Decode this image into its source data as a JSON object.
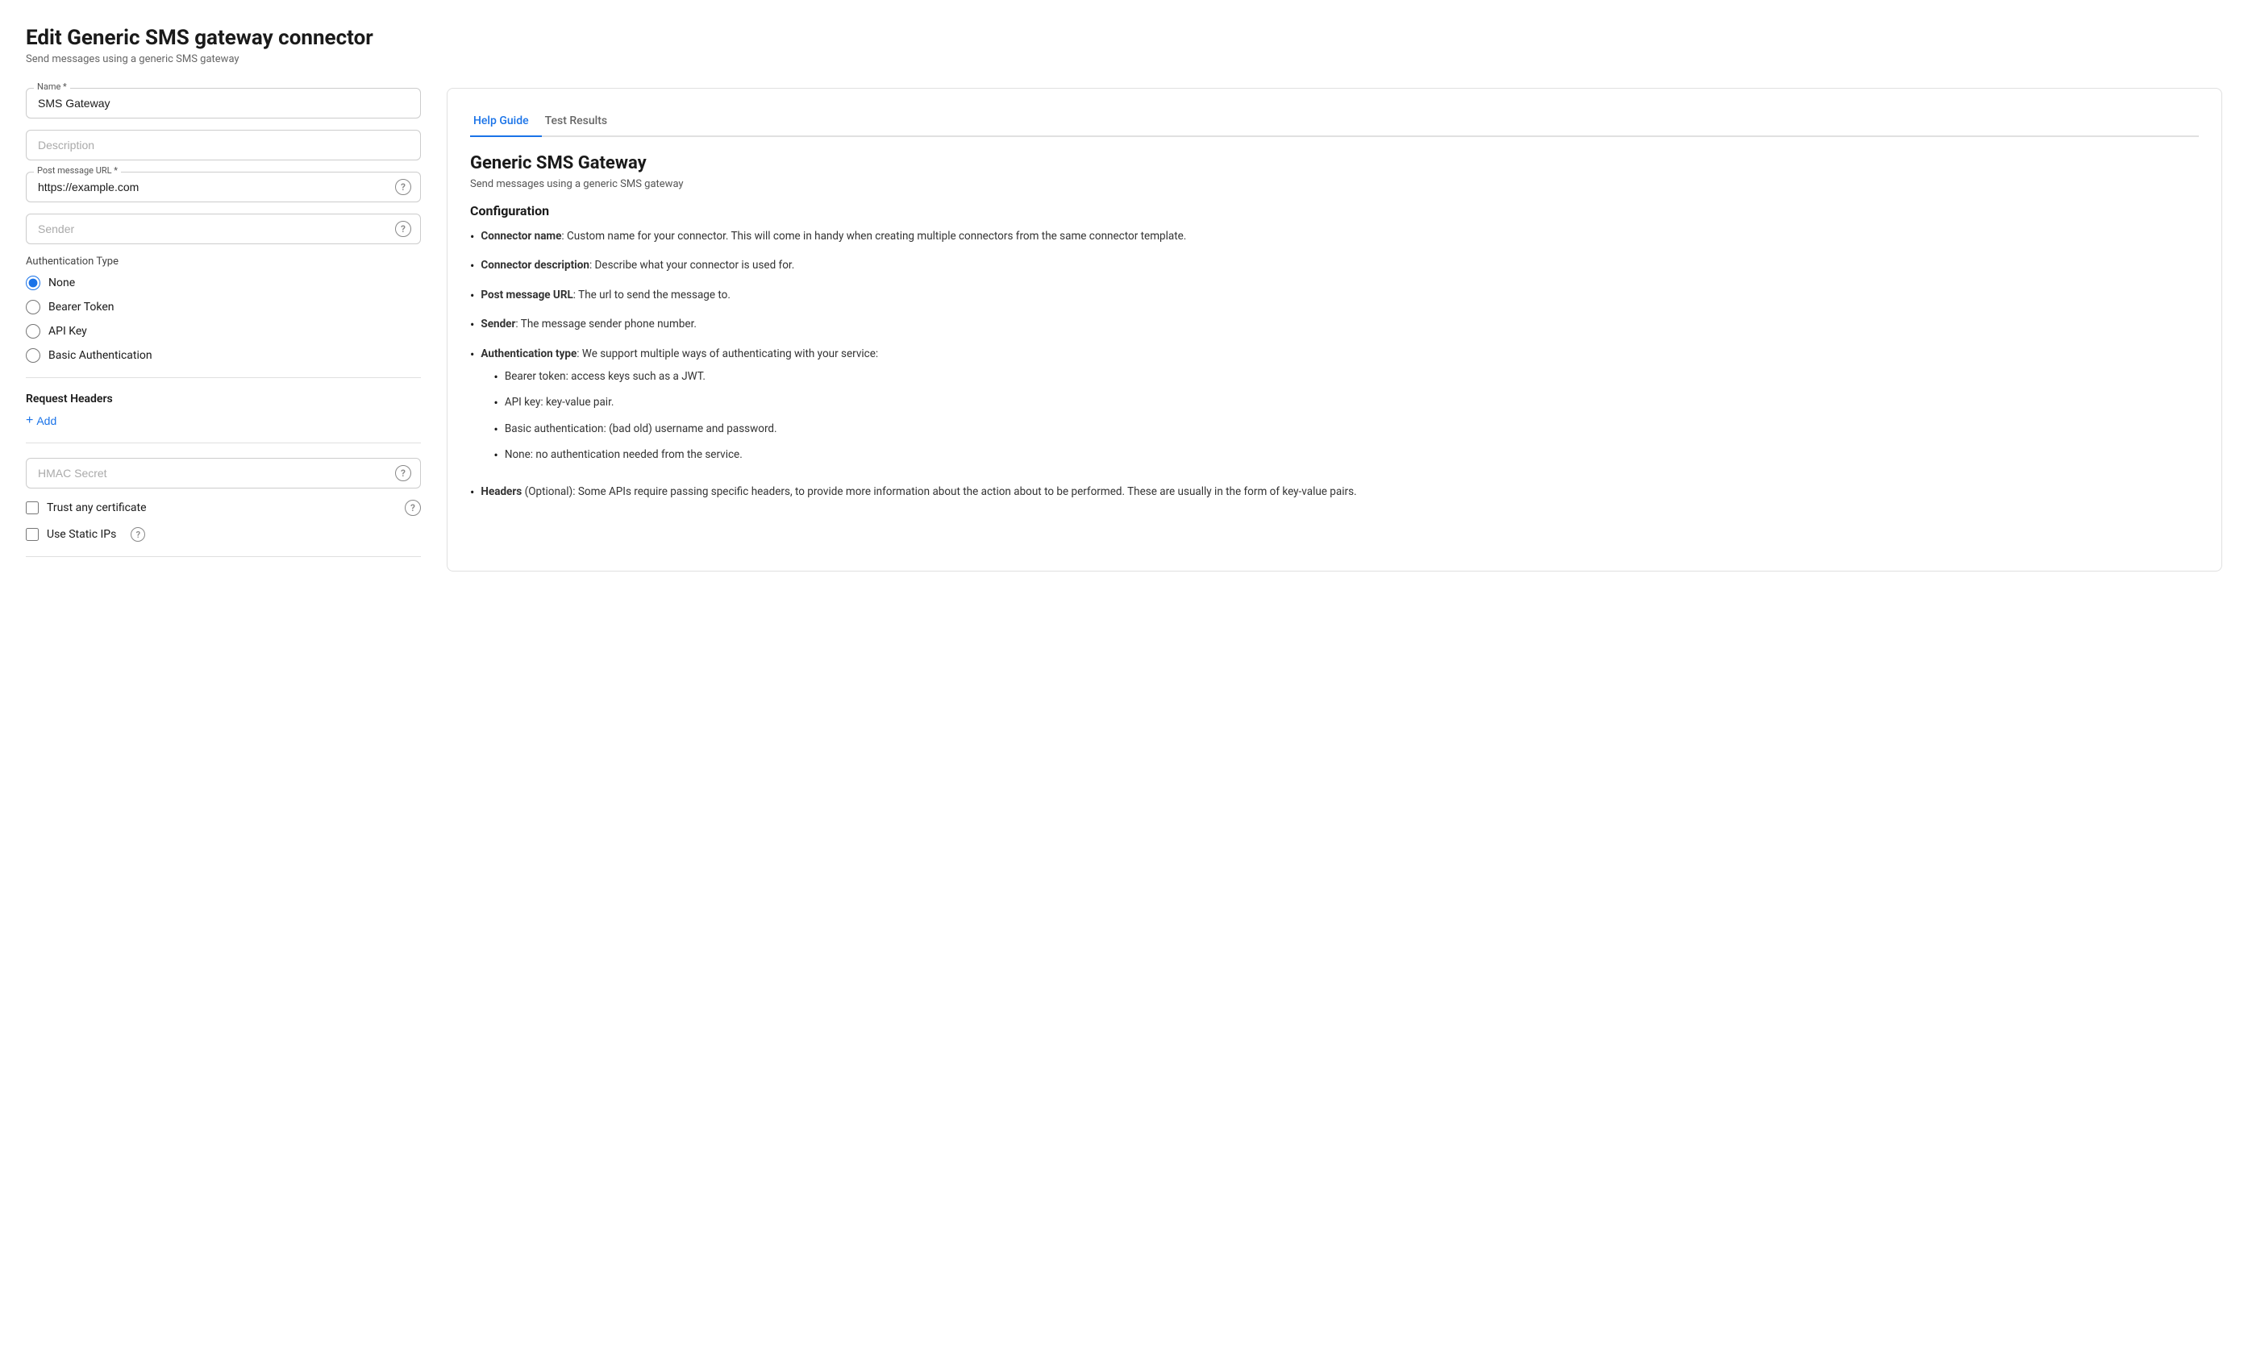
{
  "header": {
    "title": "Edit Generic SMS gateway connector",
    "subtitle": "Send messages using a generic SMS gateway"
  },
  "form": {
    "name_label": "Name *",
    "name_value": "SMS Gateway",
    "description_placeholder": "Description",
    "post_message_url_label": "Post message URL *",
    "post_message_url_value": "https://example.com",
    "sender_placeholder": "Sender",
    "auth_type_label": "Authentication Type",
    "auth_options": [
      {
        "value": "none",
        "label": "None",
        "checked": true
      },
      {
        "value": "bearer_token",
        "label": "Bearer Token",
        "checked": false
      },
      {
        "value": "api_key",
        "label": "API Key",
        "checked": false
      },
      {
        "value": "basic_auth",
        "label": "Basic Authentication",
        "checked": false
      }
    ],
    "request_headers_label": "Request Headers",
    "add_label": "Add",
    "hmac_secret_placeholder": "HMAC Secret",
    "trust_cert_label": "Trust any certificate",
    "use_static_ips_label": "Use Static IPs"
  },
  "help_panel": {
    "tab_help": "Help Guide",
    "tab_test": "Test Results",
    "title": "Generic SMS Gateway",
    "subtitle": "Send messages using a generic SMS gateway",
    "config_title": "Configuration",
    "items": [
      {
        "bold": "Connector name",
        "text": ": Custom name for your connector. This will come in handy when creating multiple connectors from the same connector template."
      },
      {
        "bold": "Connector description",
        "text": ": Describe what your connector is used for."
      },
      {
        "bold": "Post message URL",
        "text": ": The url to send the message to."
      },
      {
        "bold": "Sender",
        "text": ": The message sender phone number."
      },
      {
        "bold": "Authentication type",
        "text": ": We support multiple ways of authenticating with your service:",
        "sub_items": [
          "Bearer token: access keys such as a JWT.",
          "API key: key-value pair.",
          "Basic authentication: (bad old) username and password.",
          "None: no authentication needed from the service."
        ]
      },
      {
        "bold": "Headers",
        "bold_suffix": " (Optional)",
        "text": ": Some APIs require passing specific headers, to provide more information about the action about to be performed. These are usually in the form of key-value pairs."
      }
    ]
  }
}
